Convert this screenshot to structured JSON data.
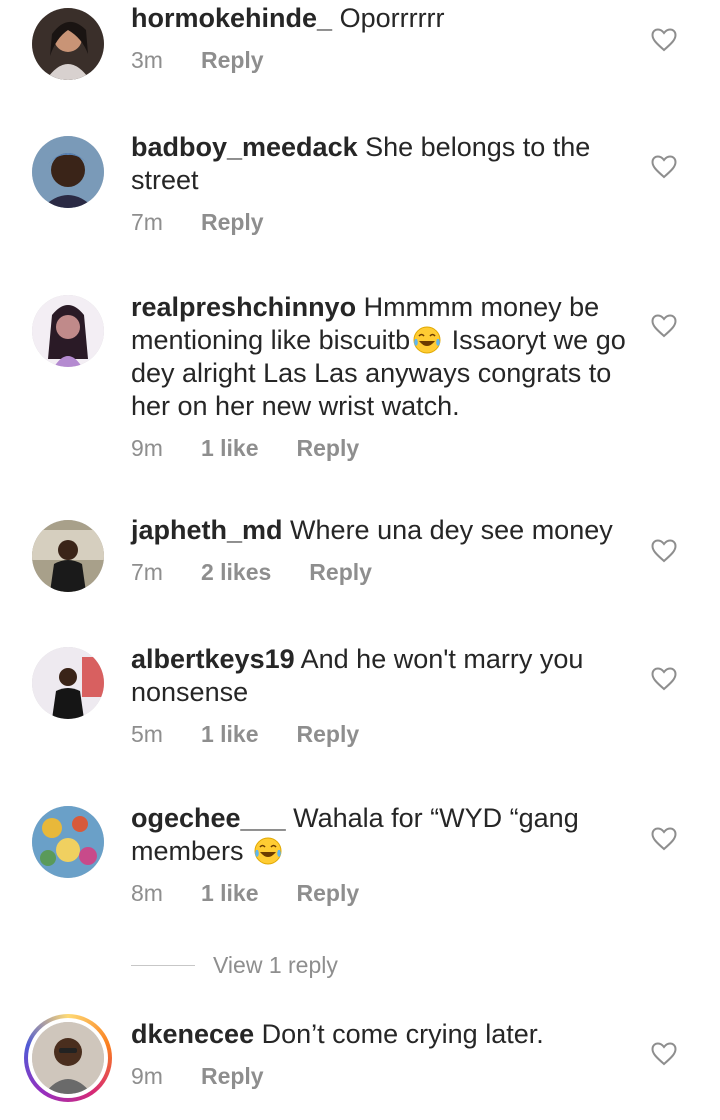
{
  "comments": [
    {
      "username": "hormokehinde_",
      "text": "Oporrrrrr",
      "time": "3m",
      "likes": "",
      "reply": "Reply"
    },
    {
      "username": "badboy_meedack",
      "text": "She belongs to the street",
      "time": "7m",
      "likes": "",
      "reply": "Reply"
    },
    {
      "username": "realpreshchinnyo",
      "text_before_emoji": "Hmmmm money be mentioning like biscuitb",
      "text_after_emoji": " Issaoryt we go dey alright Las Las anyways congrats to her on her new wrist watch.",
      "time": "9m",
      "likes": "1 like",
      "reply": "Reply"
    },
    {
      "username": "japheth_md",
      "text": "Where una dey see money",
      "time": "7m",
      "likes": "2 likes",
      "reply": "Reply"
    },
    {
      "username": "albertkeys19",
      "text": "And he won't marry you nonsense",
      "time": "5m",
      "likes": "1 like",
      "reply": "Reply"
    },
    {
      "username": "ogechee___",
      "text_before_emoji": "Wahala for “WYD “gang members ",
      "time": "8m",
      "likes": "1 like",
      "reply": "Reply"
    },
    {
      "username": "dkenecee",
      "text": "Don’t come crying later.",
      "time": "9m",
      "likes": "",
      "reply": "Reply"
    }
  ],
  "view_replies": "View 1 reply",
  "icons": {
    "like": "heart-outline-icon",
    "emoji": "tears-of-joy-emoji"
  },
  "colors": {
    "text": "#262626",
    "secondary": "#8e8e8e",
    "story_ring": "#d62976"
  }
}
